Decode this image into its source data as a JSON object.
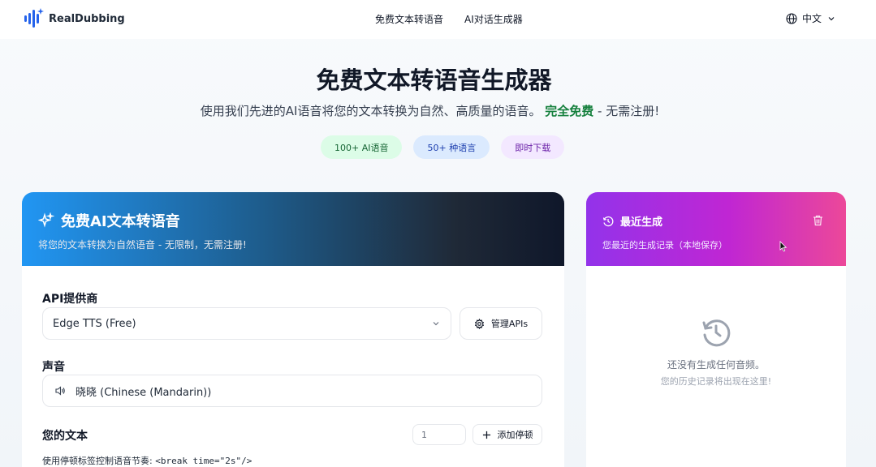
{
  "header": {
    "brand": "RealDubbing",
    "nav": [
      "免费文本转语音",
      "AI对话生成器"
    ],
    "language": "中文"
  },
  "hero": {
    "title": "免费文本转语音生成器",
    "subtitle_prefix": "使用我们先进的AI语音将您的文本转换为自然、高质量的语音。",
    "subtitle_highlight": "完全免费",
    "subtitle_suffix": " - 无需注册!",
    "badges": [
      "100+ AI语音",
      "50+ 种语言",
      "即时下载"
    ]
  },
  "main_card": {
    "title": "免费AI文本转语音",
    "description": "将您的文本转换为自然语音 - 无限制，无需注册!",
    "api_label": "API提供商",
    "api_value": "Edge TTS (Free)",
    "manage_label": "管理APIs",
    "voice_label": "声音",
    "voice_value": "晓晓 (Chinese (Mandarin))",
    "text_label": "您的文本",
    "pause_value": "1",
    "add_pause_label": "添加停顿",
    "hint_prefix": "使用停顿标签控制语音节奏: ",
    "hint_code": "<break time=\"2s\"/>"
  },
  "side_card": {
    "title": "最近生成",
    "description": "您最近的生成记录（本地保存）",
    "empty_message": "还没有生成任何音频。",
    "empty_sub": "您的历史记录将出现在这里!"
  },
  "colors": {
    "accent_blue": "#2196f3",
    "accent_purple": "#9333ea",
    "accent_pink": "#ec4899",
    "free_green": "#15803d"
  }
}
